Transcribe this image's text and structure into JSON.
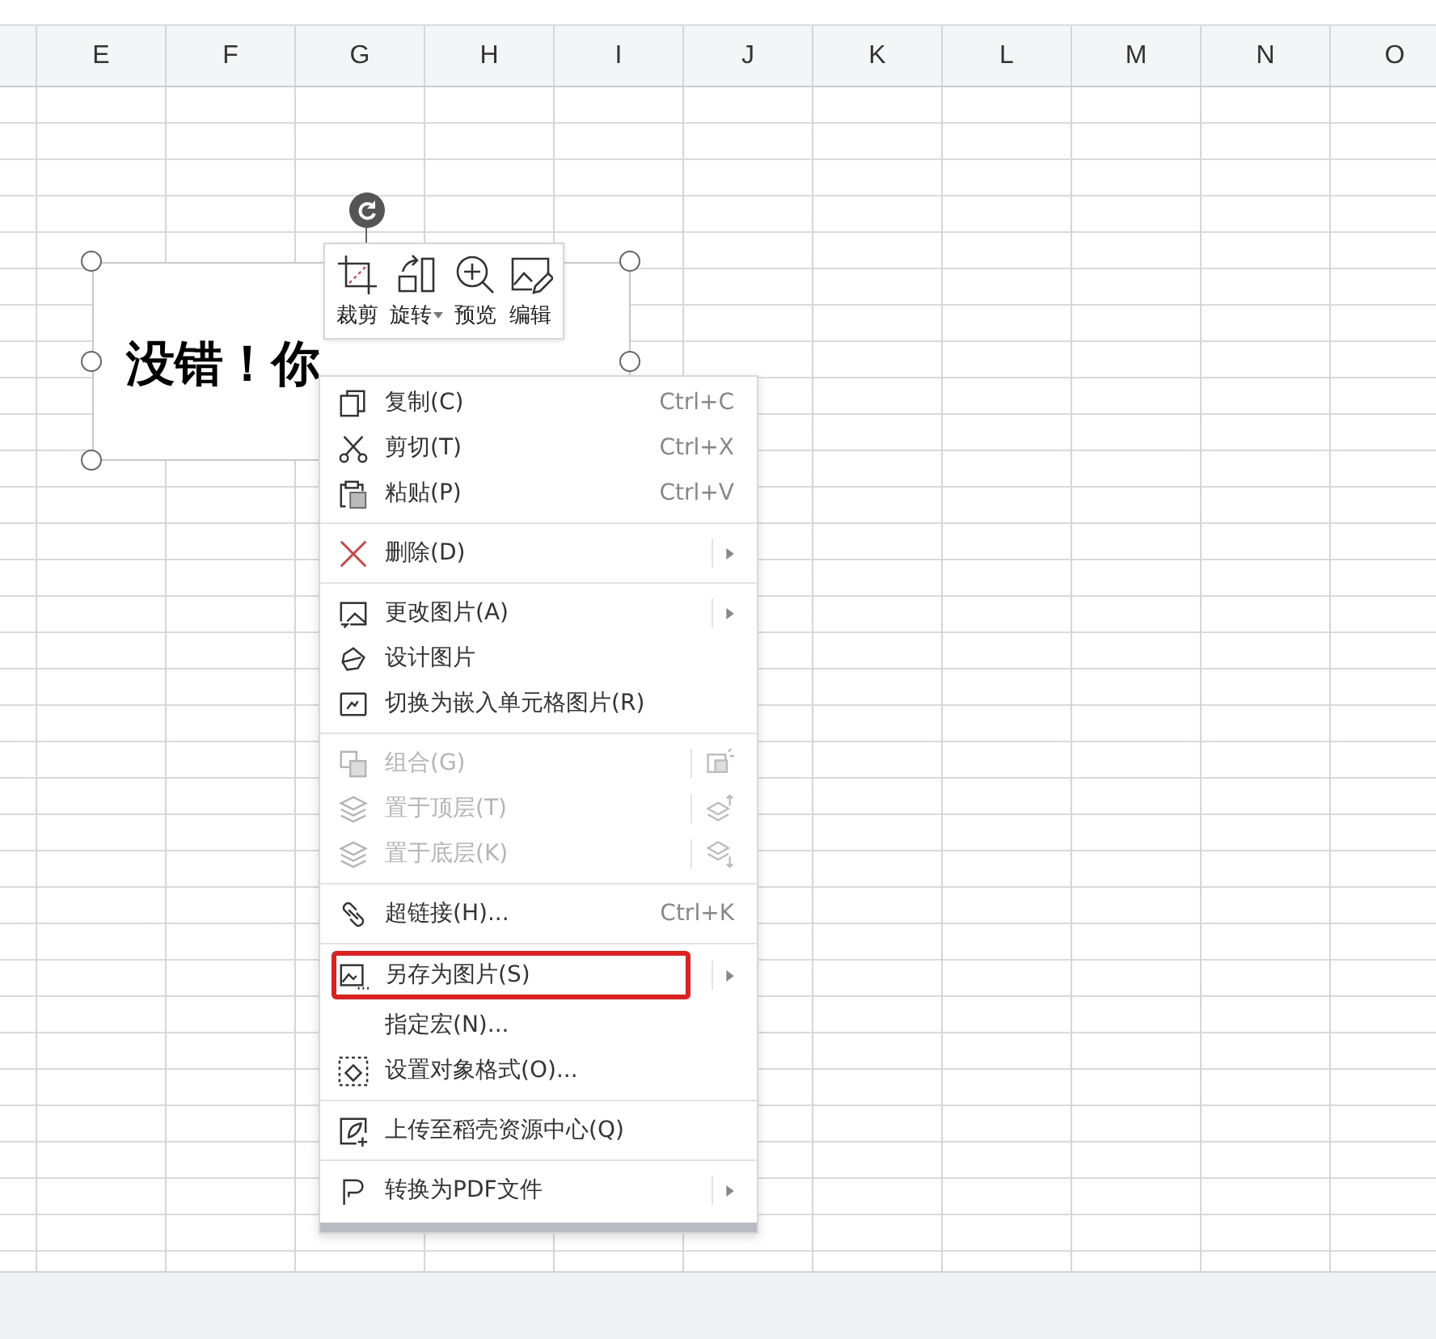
{
  "columns": [
    "E",
    "F",
    "G",
    "H",
    "I",
    "J",
    "K",
    "L",
    "M",
    "N",
    "O"
  ],
  "picture_object": {
    "text": "没错！你"
  },
  "picture_toolbar": [
    {
      "label": "裁剪",
      "dropdown": false
    },
    {
      "label": "旋转",
      "dropdown": true
    },
    {
      "label": "预览",
      "dropdown": false
    },
    {
      "label": "编辑",
      "dropdown": false
    }
  ],
  "context_menu": {
    "groups": [
      [
        {
          "label": "复制(C)",
          "shortcut": "Ctrl+C",
          "submenu": false,
          "disabled": false,
          "outlined": false
        },
        {
          "label": "剪切(T)",
          "shortcut": "Ctrl+X",
          "submenu": false,
          "disabled": false,
          "outlined": false
        },
        {
          "label": "粘贴(P)",
          "shortcut": "Ctrl+V",
          "submenu": false,
          "disabled": false,
          "outlined": false
        }
      ],
      [
        {
          "label": "删除(D)",
          "submenu": true,
          "disabled": false,
          "outlined": false
        }
      ],
      [
        {
          "label": "更改图片(A)",
          "submenu": true,
          "disabled": false,
          "outlined": false
        },
        {
          "label": "设计图片",
          "submenu": false,
          "disabled": false,
          "outlined": false
        },
        {
          "label": "切换为嵌入单元格图片(R)",
          "submenu": false,
          "disabled": false,
          "outlined": false
        }
      ],
      [
        {
          "label": "组合(G)",
          "submenu": false,
          "disabled": true,
          "outlined": false
        },
        {
          "label": "置于顶层(T)",
          "submenu": false,
          "disabled": true,
          "outlined": false
        },
        {
          "label": "置于底层(K)",
          "submenu": false,
          "disabled": true,
          "outlined": false
        }
      ],
      [
        {
          "label": "超链接(H)...",
          "shortcut": "Ctrl+K",
          "submenu": false,
          "disabled": false,
          "outlined": false
        }
      ],
      [
        {
          "label": "另存为图片(S)",
          "submenu": true,
          "disabled": false,
          "outlined": true
        },
        {
          "label": "指定宏(N)...",
          "submenu": false,
          "disabled": false,
          "outlined": false
        },
        {
          "label": "设置对象格式(O)...",
          "submenu": false,
          "disabled": false,
          "outlined": false
        }
      ],
      [
        {
          "label": "上传至稻壳资源中心(Q)",
          "submenu": false,
          "disabled": false,
          "outlined": false
        }
      ],
      [
        {
          "label": "转换为PDF文件",
          "submenu": true,
          "disabled": false,
          "outlined": false
        }
      ]
    ]
  }
}
